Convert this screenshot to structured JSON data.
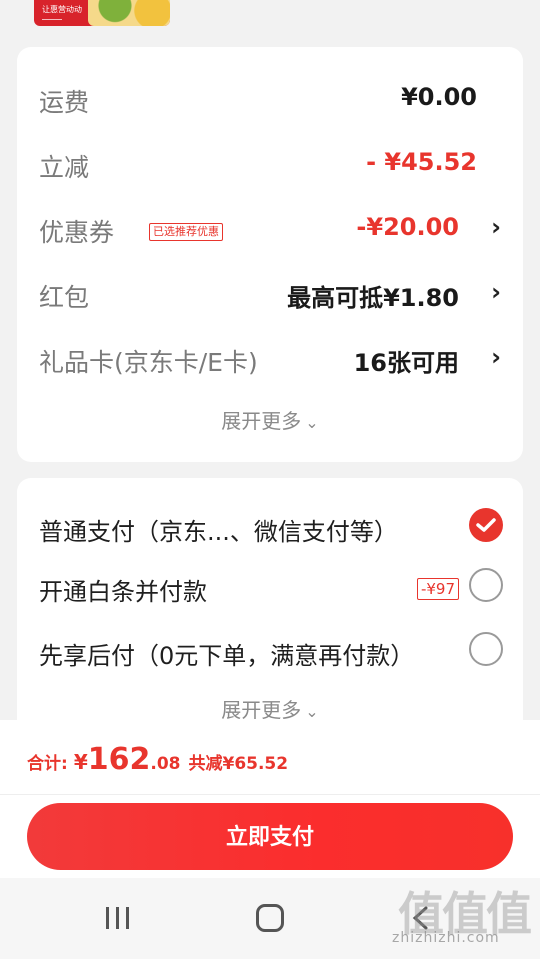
{
  "fees": {
    "shipping": {
      "label": "运费",
      "value": "¥0.00"
    },
    "instant_discount": {
      "label": "立减",
      "value": "- ¥45.52"
    },
    "coupon": {
      "label": "优惠券",
      "tag": "已选推荐优惠",
      "value": "-¥20.00"
    },
    "red_packet": {
      "label": "红包",
      "value": "最高可抵¥1.80"
    },
    "gift_card": {
      "label": "礼品卡(京东卡/E卡)",
      "value": "16张可用"
    },
    "expand_label": "展开更多"
  },
  "payment": {
    "options": [
      {
        "label": "普通支付（京东...、微信支付等）",
        "selected": true
      },
      {
        "label": "开通白条并付款",
        "tag": "-¥97",
        "selected": false
      },
      {
        "label": "先享后付（0元下单，满意再付款）",
        "selected": false
      }
    ],
    "expand_label": "展开更多"
  },
  "summary": {
    "total_label": "合计:",
    "currency": "¥",
    "total_integer": "162",
    "total_decimal": ".08",
    "saved": "共减¥65.52"
  },
  "pay_button_label": "立即支付",
  "watermark": {
    "chars": "值值值",
    "url": "zhizhizhi.com"
  },
  "colors": {
    "accent": "#e8352d",
    "button": "#fb2d2d"
  }
}
